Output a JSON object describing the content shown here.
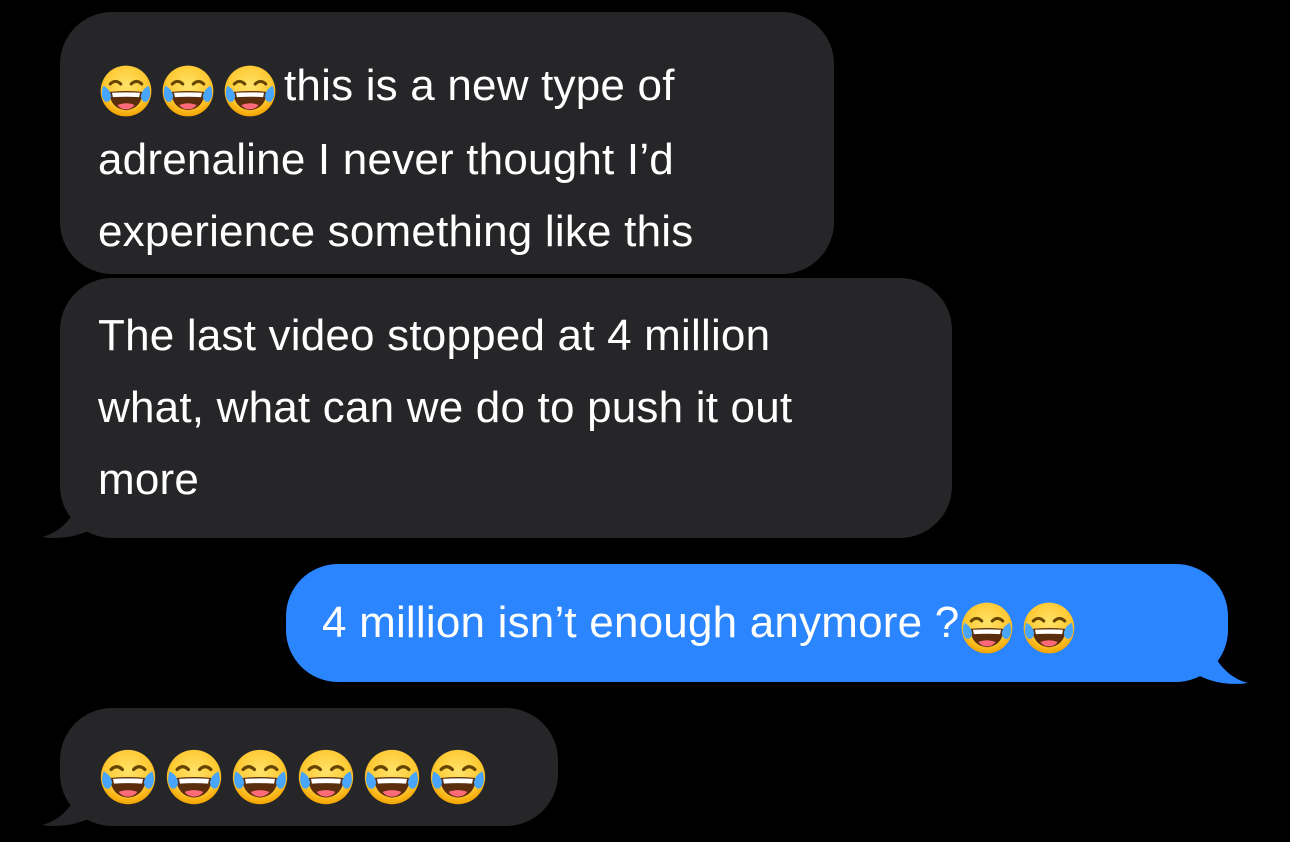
{
  "conversation": {
    "messages": [
      {
        "direction": "incoming",
        "leading_emojis": [
          "face-with-tears-of-joy",
          "face-with-tears-of-joy",
          "face-with-tears-of-joy"
        ],
        "lines": [
          "this is a new type of",
          "adrenaline I never thought I’d",
          "experience something like this"
        ]
      },
      {
        "direction": "incoming",
        "lines": [
          "The last video stopped at 4 million",
          "what, what can we do to push it out",
          "more"
        ]
      },
      {
        "direction": "outgoing",
        "text": "4 million isn’t enough anymore ?",
        "trailing_emojis": [
          "face-with-tears-of-joy",
          "face-with-tears-of-joy"
        ]
      },
      {
        "direction": "incoming",
        "emojis": [
          "face-with-tears-of-joy",
          "face-with-tears-of-joy",
          "face-with-tears-of-joy",
          "face-with-tears-of-joy",
          "face-with-tears-of-joy",
          "face-with-tears-of-joy"
        ]
      }
    ]
  },
  "colors": {
    "background": "#000000",
    "incoming_bubble": "#262628",
    "outgoing_bubble": "#2a85ff",
    "text": "#ffffff"
  }
}
